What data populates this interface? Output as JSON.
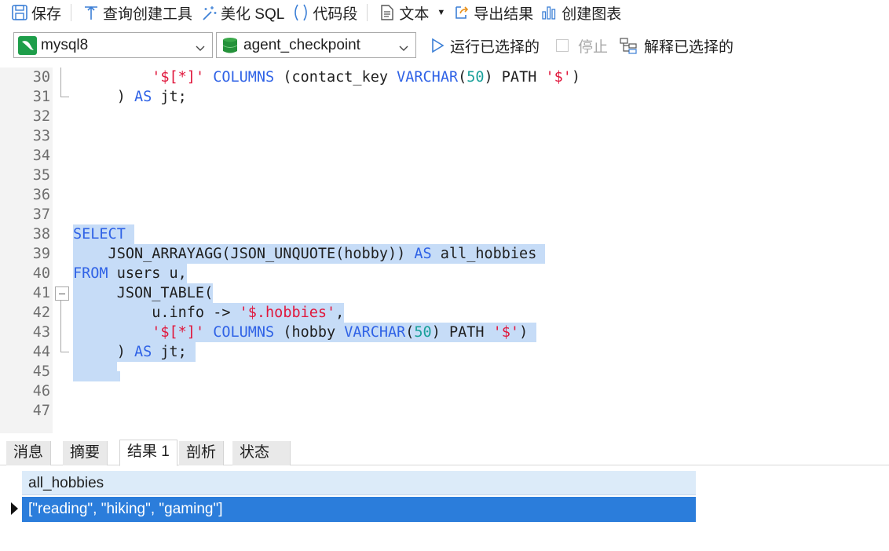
{
  "toolbar": {
    "save": "保存",
    "query_builder": "查询创建工具",
    "beautify_sql": "美化 SQL",
    "code_snippet": "代码段",
    "text": "文本",
    "export_result": "导出结果",
    "create_chart": "创建图表"
  },
  "connection": {
    "server": "mysql8",
    "database": "agent_checkpoint"
  },
  "actions": {
    "run_selected": "运行已选择的",
    "stop": "停止",
    "explain_selected": "解释已选择的"
  },
  "editor": {
    "line_numbers": [
      "30",
      "31",
      "32",
      "33",
      "34",
      "35",
      "36",
      "37",
      "38",
      "39",
      "40",
      "41",
      "42",
      "43",
      "44",
      "45",
      "46",
      "47"
    ]
  },
  "tabs": [
    "消息",
    "摘要",
    "结果 1",
    "剖析",
    "状态"
  ],
  "result": {
    "column": "all_hobbies",
    "row_value": "[\"reading\", \"hiking\", \"gaming\"]"
  },
  "colors": {
    "keyword": "#2f62e6",
    "string": "#e0173c",
    "number": "#19a09a",
    "selection": "#c6dcf7",
    "selected_row": "#2b7ddb"
  }
}
